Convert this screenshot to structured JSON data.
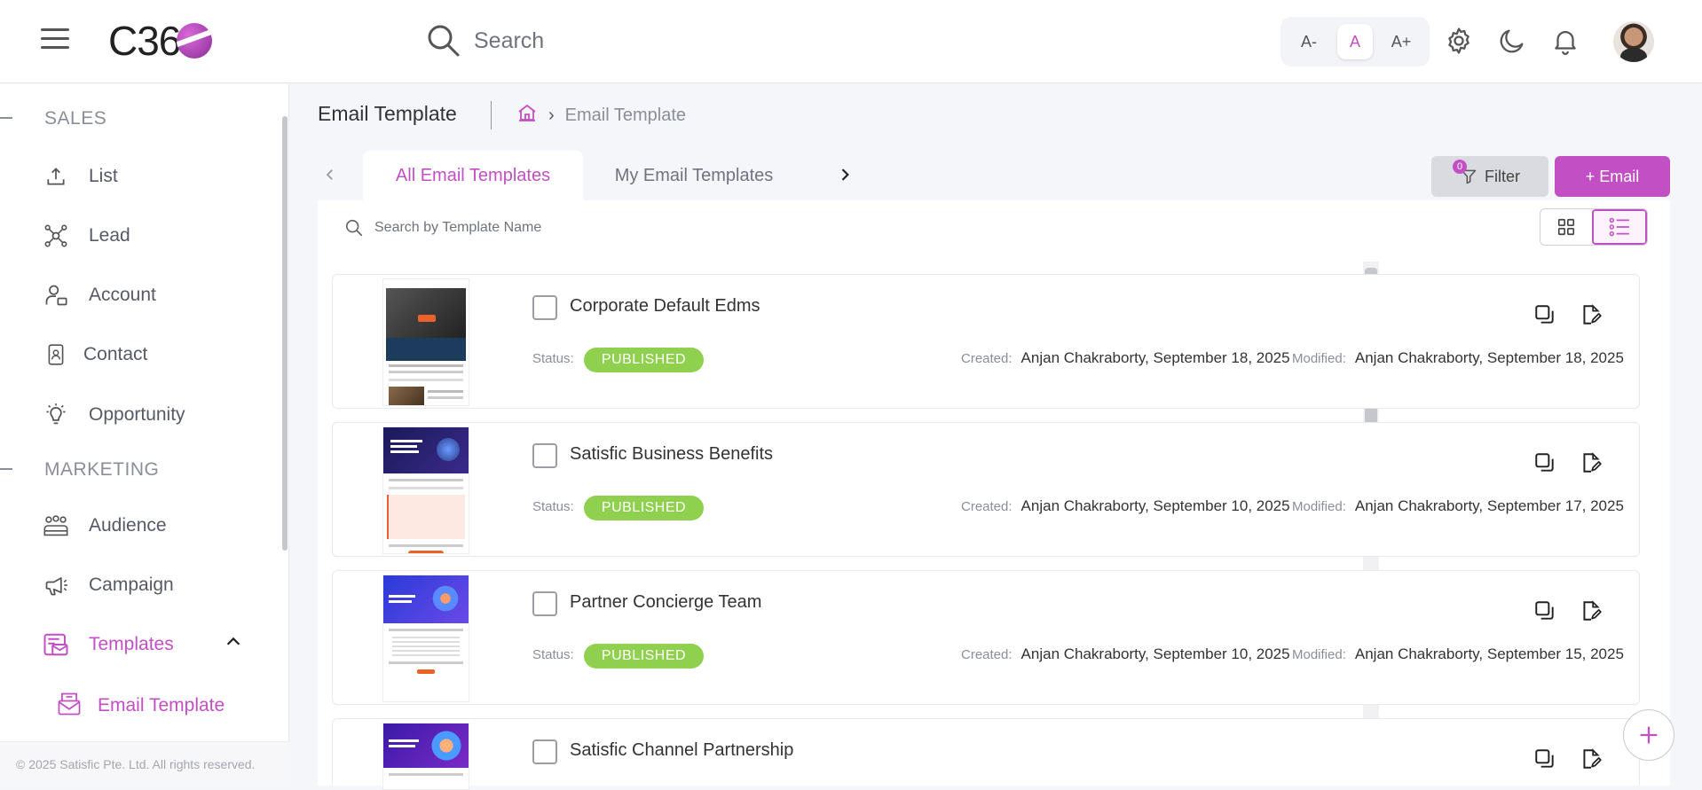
{
  "header": {
    "logo_text": "C36",
    "search_placeholder": "Search",
    "font_sizes": [
      "A-",
      "A",
      "A+"
    ],
    "accent": "#c24fc4"
  },
  "sidebar": {
    "sections": [
      {
        "title": "SALES",
        "items": [
          {
            "label": "List",
            "icon": "upload-icon"
          },
          {
            "label": "Lead",
            "icon": "lead-network-icon"
          },
          {
            "label": "Account",
            "icon": "account-icon"
          },
          {
            "label": "Contact",
            "icon": "contact-icon"
          },
          {
            "label": "Opportunity",
            "icon": "lightbulb-icon"
          }
        ]
      },
      {
        "title": "MARKETING",
        "items": [
          {
            "label": "Audience",
            "icon": "audience-icon"
          },
          {
            "label": "Campaign",
            "icon": "megaphone-icon"
          },
          {
            "label": "Templates",
            "icon": "templates-icon"
          }
        ]
      }
    ],
    "sub_item": "Email Template",
    "copyright": "© 2025 Satisfic Pte. Ltd. All rights reserved."
  },
  "page": {
    "title": "Email Template",
    "breadcrumb_current": "Email Template",
    "tabs": [
      "All Email Templates",
      "My Email Templates"
    ],
    "filter_label": "Filter",
    "filter_count": "0",
    "add_email_label": "+ Email",
    "list_search_placeholder": "Search by Template Name"
  },
  "templates": [
    {
      "name": "Corporate Default Edms",
      "status_label": "Status:",
      "status": "PUBLISHED",
      "created_label": "Created:",
      "created": "Anjan Chakraborty, September 18, 2025",
      "modified_label": "Modified:",
      "modified": "Anjan Chakraborty, September 18, 2025"
    },
    {
      "name": "Satisfic Business Benefits",
      "status_label": "Status:",
      "status": "PUBLISHED",
      "created_label": "Created:",
      "created": "Anjan Chakraborty, September 10, 2025",
      "modified_label": "Modified:",
      "modified": "Anjan Chakraborty, September 17, 2025"
    },
    {
      "name": "Partner Concierge Team",
      "status_label": "Status:",
      "status": "PUBLISHED",
      "created_label": "Created:",
      "created": "Anjan Chakraborty, September 10, 2025",
      "modified_label": "Modified:",
      "modified": "Anjan Chakraborty, September 15, 2025"
    },
    {
      "name": "Satisfic Channel Partnership"
    }
  ]
}
